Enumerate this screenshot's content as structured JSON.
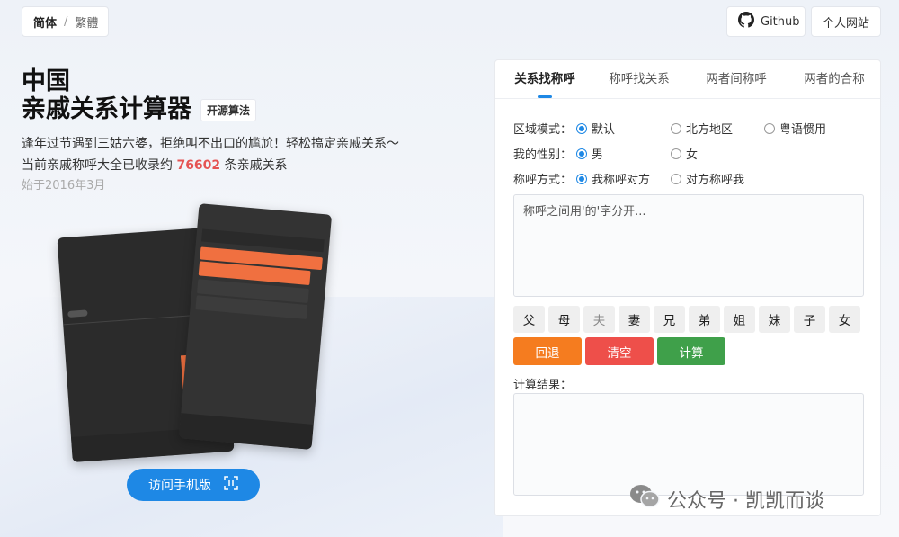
{
  "lang": {
    "active": "简体",
    "sep": "/",
    "other": "繁體"
  },
  "header": {
    "github_label": "Github",
    "site_label": "个人网站"
  },
  "hero": {
    "title_line1": "中国",
    "title_line2": "亲戚关系计算器",
    "badge": "开源算法",
    "desc_line1": "逢年过节遇到三姑六婆，拒绝叫不出口的尴尬！轻松搞定亲戚关系～",
    "desc_line2_prefix": "当前亲戚称呼大全已收录约 ",
    "count": "76602",
    "desc_line2_suffix": " 条亲戚关系",
    "since": "始于2016年3月"
  },
  "mobile_button": {
    "label": "访问手机版"
  },
  "panel": {
    "tabs": [
      {
        "label": "关系找称呼",
        "active": true
      },
      {
        "label": "称呼找关系",
        "active": false
      },
      {
        "label": "两者间称呼",
        "active": false
      },
      {
        "label": "两者的合称",
        "active": false
      }
    ],
    "region": {
      "label": "区域模式：",
      "options": [
        "默认",
        "北方地区",
        "粤语惯用"
      ],
      "selected": 0
    },
    "gender": {
      "label": "我的性别：",
      "options": [
        "男",
        "女"
      ],
      "selected": 0
    },
    "mode": {
      "label": "称呼方式：",
      "options": [
        "我称呼对方",
        "对方称呼我"
      ],
      "selected": 0
    },
    "input": {
      "placeholder": "称呼之间用'的'字分开..."
    },
    "keys": [
      "父",
      "母",
      "夫",
      "妻",
      "兄",
      "弟",
      "姐",
      "妹",
      "子",
      "女"
    ],
    "actions": {
      "back": "回退",
      "clear": "清空",
      "calc": "计算"
    },
    "result_label": "计算结果："
  },
  "watermark": {
    "text": "公众号 · 凯凯而谈"
  }
}
